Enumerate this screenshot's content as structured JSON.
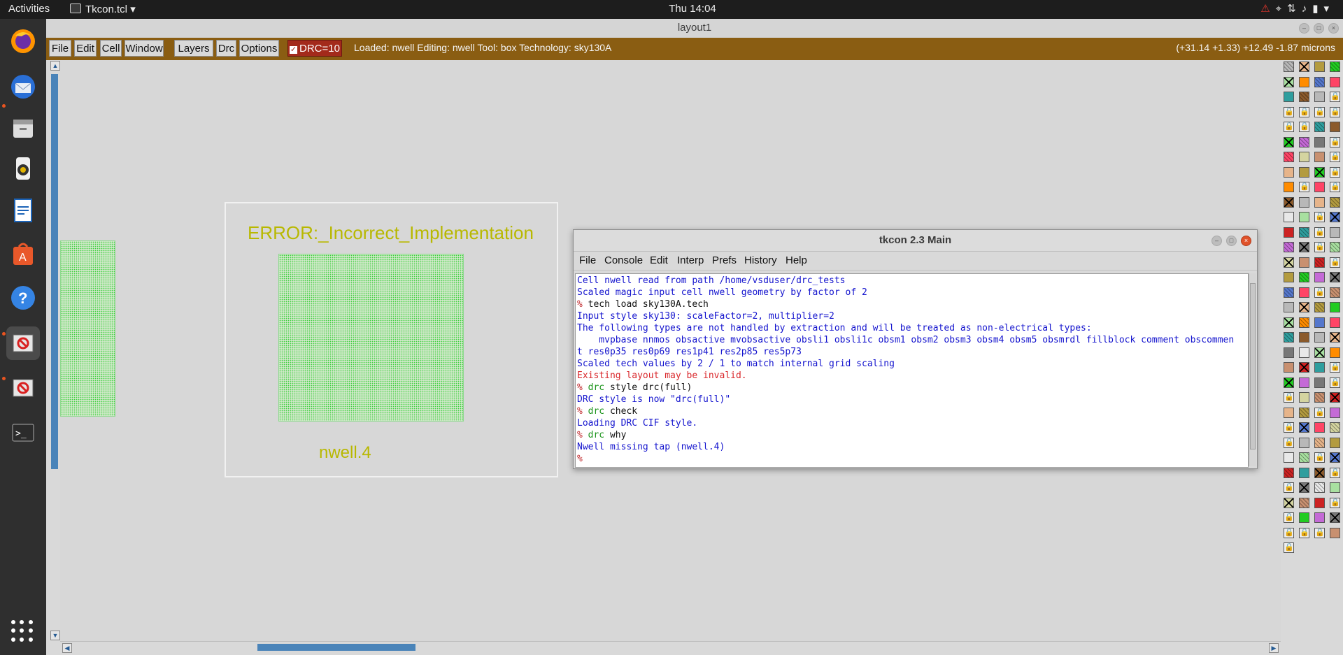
{
  "topbar": {
    "activities": "Activities",
    "app_name": "Tkcon.tcl",
    "app_menu_arrow": "▾",
    "clock": "Thu 14:04"
  },
  "window": {
    "title": "layout1",
    "menu": [
      "File",
      "Edit",
      "Cell",
      "Window",
      "Layers",
      "Drc",
      "Options"
    ],
    "drc_label": "DRC=10",
    "status": "Loaded: nwell Editing: nwell Tool: box  Technology: sky130A",
    "coords": "(+31.14 +1.33) +12.49 -1.87 microns"
  },
  "canvas": {
    "error_label": "ERROR:_Incorrect_Implementation",
    "cell_label": "nwell.4"
  },
  "tkcon": {
    "title": "tkcon 2.3 Main",
    "menu": [
      "File",
      "Console",
      "Edit",
      "Interp",
      "Prefs",
      "History",
      "Help"
    ],
    "lines": [
      {
        "type": "out",
        "text": "Cell nwell read from path /home/vsduser/drc_tests"
      },
      {
        "type": "out",
        "text": "Scaled magic input cell nwell geometry by factor of 2"
      },
      {
        "type": "cmd",
        "prompt": "%",
        "kw": "",
        "text": "tech load sky130A.tech"
      },
      {
        "type": "out",
        "text": "Input style sky130: scaleFactor=2, multiplier=2"
      },
      {
        "type": "out",
        "text": "The following types are not handled by extraction and will be treated as non-electrical types:"
      },
      {
        "type": "out",
        "text": "    mvpbase nnmos obsactive mvobsactive obsli1 obsli1c obsm1 obsm2 obsm3 obsm4 obsm5 obsmrdl fillblock comment obscommen"
      },
      {
        "type": "out",
        "text": "t res0p35 res0p69 res1p41 res2p85 res5p73"
      },
      {
        "type": "out",
        "text": "Scaled tech values by 2 / 1 to match internal grid scaling"
      },
      {
        "type": "err",
        "text": "Existing layout may be invalid."
      },
      {
        "type": "cmd",
        "prompt": "%",
        "kw": "drc",
        "text": "style drc(full)"
      },
      {
        "type": "out",
        "text": "DRC style is now \"drc(full)\""
      },
      {
        "type": "cmd",
        "prompt": "%",
        "kw": "drc",
        "text": "check"
      },
      {
        "type": "out",
        "text": "Loading DRC CIF style."
      },
      {
        "type": "cmd",
        "prompt": "%",
        "kw": "drc",
        "text": "why"
      },
      {
        "type": "out",
        "text": "Nwell missing tap (nwell.4)"
      },
      {
        "type": "cmd",
        "prompt": "%",
        "kw": "",
        "text": ""
      }
    ]
  },
  "dock": {
    "items": [
      "firefox-icon",
      "thunderbird-icon",
      "files-icon",
      "rhythmbox-icon",
      "writer-icon",
      "software-icon",
      "help-icon",
      "tkcon-icon",
      "magic-icon",
      "terminal-icon"
    ]
  },
  "palette_colors": [
    "#b8b8b8",
    "#d4d4a0",
    "#e8e8e8",
    "#e6b48a",
    "#c89070",
    "#a8e0a0",
    "#b39b3f",
    "#cc2222",
    "#ff8c00",
    "#22cc22",
    "#2f9e9e",
    "#5577cc",
    "#c46ad6",
    "#8b5a2b",
    "#ff4466",
    "#777777"
  ]
}
